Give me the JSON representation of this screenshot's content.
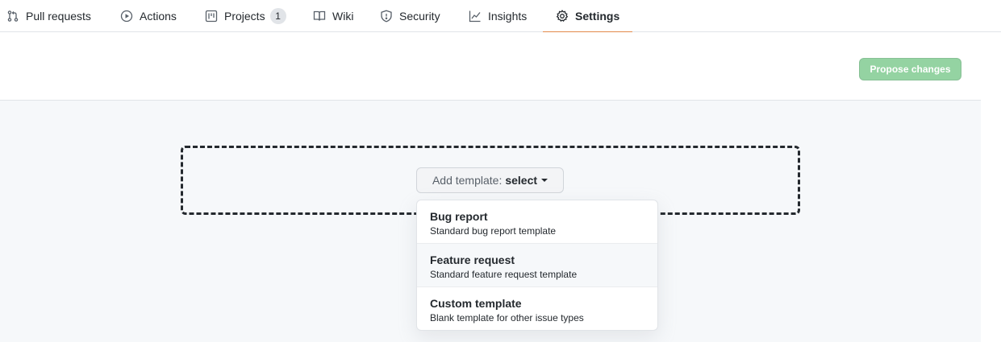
{
  "tabs": [
    {
      "label": "Pull requests",
      "icon": "git-pull-request-icon"
    },
    {
      "label": "Actions",
      "icon": "play-icon"
    },
    {
      "label": "Projects",
      "icon": "project-icon",
      "count": "1"
    },
    {
      "label": "Wiki",
      "icon": "book-icon"
    },
    {
      "label": "Security",
      "icon": "shield-icon"
    },
    {
      "label": "Insights",
      "icon": "graph-icon"
    },
    {
      "label": "Settings",
      "icon": "gear-icon",
      "selected": true
    }
  ],
  "toolbar": {
    "propose_label": "Propose changes"
  },
  "template_select": {
    "prefix": "Add template:",
    "value": "select"
  },
  "menu": {
    "items": [
      {
        "title": "Bug report",
        "description": "Standard bug report template"
      },
      {
        "title": "Feature request",
        "description": "Standard feature request template"
      },
      {
        "title": "Custom template",
        "description": "Blank template for other issue types"
      }
    ]
  },
  "colors": {
    "accent_underline": "#e36209",
    "propose_button": "#94d3a2",
    "background_gray": "#f6f8fa"
  }
}
